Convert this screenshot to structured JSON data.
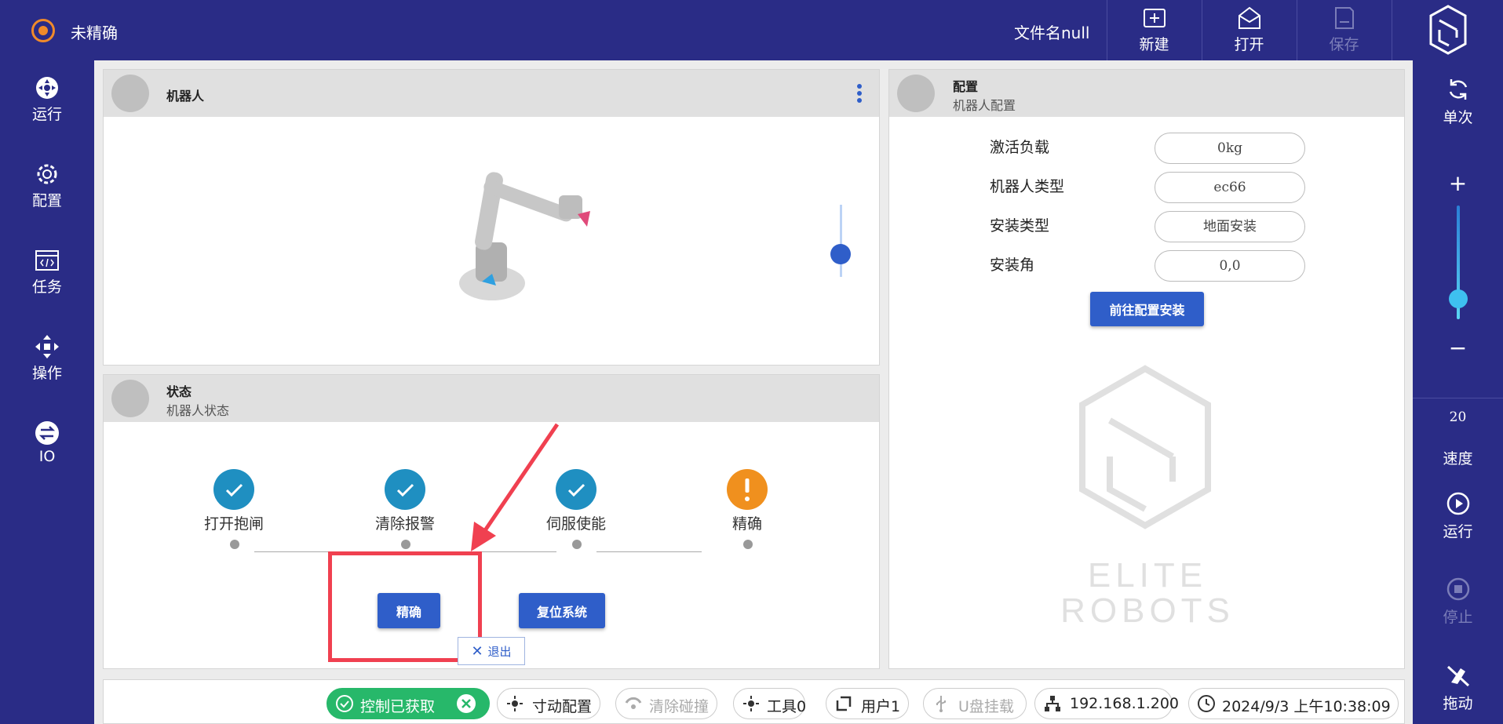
{
  "topbar": {
    "status": "未精确",
    "filename": "文件名null",
    "buttons": {
      "new": "新建",
      "open": "打开",
      "save": "保存"
    }
  },
  "leftnav": {
    "run": "运行",
    "config": "配置",
    "task": "任务",
    "operate": "操作",
    "io": "IO"
  },
  "rightnav": {
    "single": "单次",
    "plus": "+",
    "minus": "−",
    "speed_value": "20",
    "speed": "速度",
    "run": "运行",
    "stop": "停止",
    "drag": "拖动"
  },
  "robot_panel": {
    "title": "机器人"
  },
  "status_panel": {
    "title": "状态",
    "subtitle": "机器人状态",
    "steps": [
      "打开抱闸",
      "清除报警",
      "伺服使能",
      "精确"
    ],
    "precise_button": "精确",
    "reset_button": "复位系统",
    "exit_button": "退出"
  },
  "config_panel": {
    "title": "配置",
    "subtitle": "机器人配置",
    "rows": [
      {
        "label": "激活负载",
        "value": "0kg"
      },
      {
        "label": "机器人类型",
        "value": "ec66"
      },
      {
        "label": "安装类型",
        "value": "地面安装"
      },
      {
        "label": "安装角",
        "value": "0,0"
      }
    ],
    "goto_button": "前往配置安装",
    "logo_line1": "ELITE",
    "logo_line2": "ROBOTS"
  },
  "bottombar": {
    "control": "控制已获取",
    "jog_config": "寸动配置",
    "clear_collision": "清除碰撞",
    "tool": "工具0",
    "user": "用户1",
    "usb": "U盘挂载",
    "ip": "192.168.1.200",
    "datetime": "2024/9/3 上午10:38:09"
  },
  "colors": {
    "nav_bg": "#2a2c86",
    "accent_blue": "#2f5ec9",
    "step_done": "#1f8fc1",
    "step_warn": "#f0901e",
    "annotation": "#f04050",
    "control_green": "#27b86a"
  }
}
